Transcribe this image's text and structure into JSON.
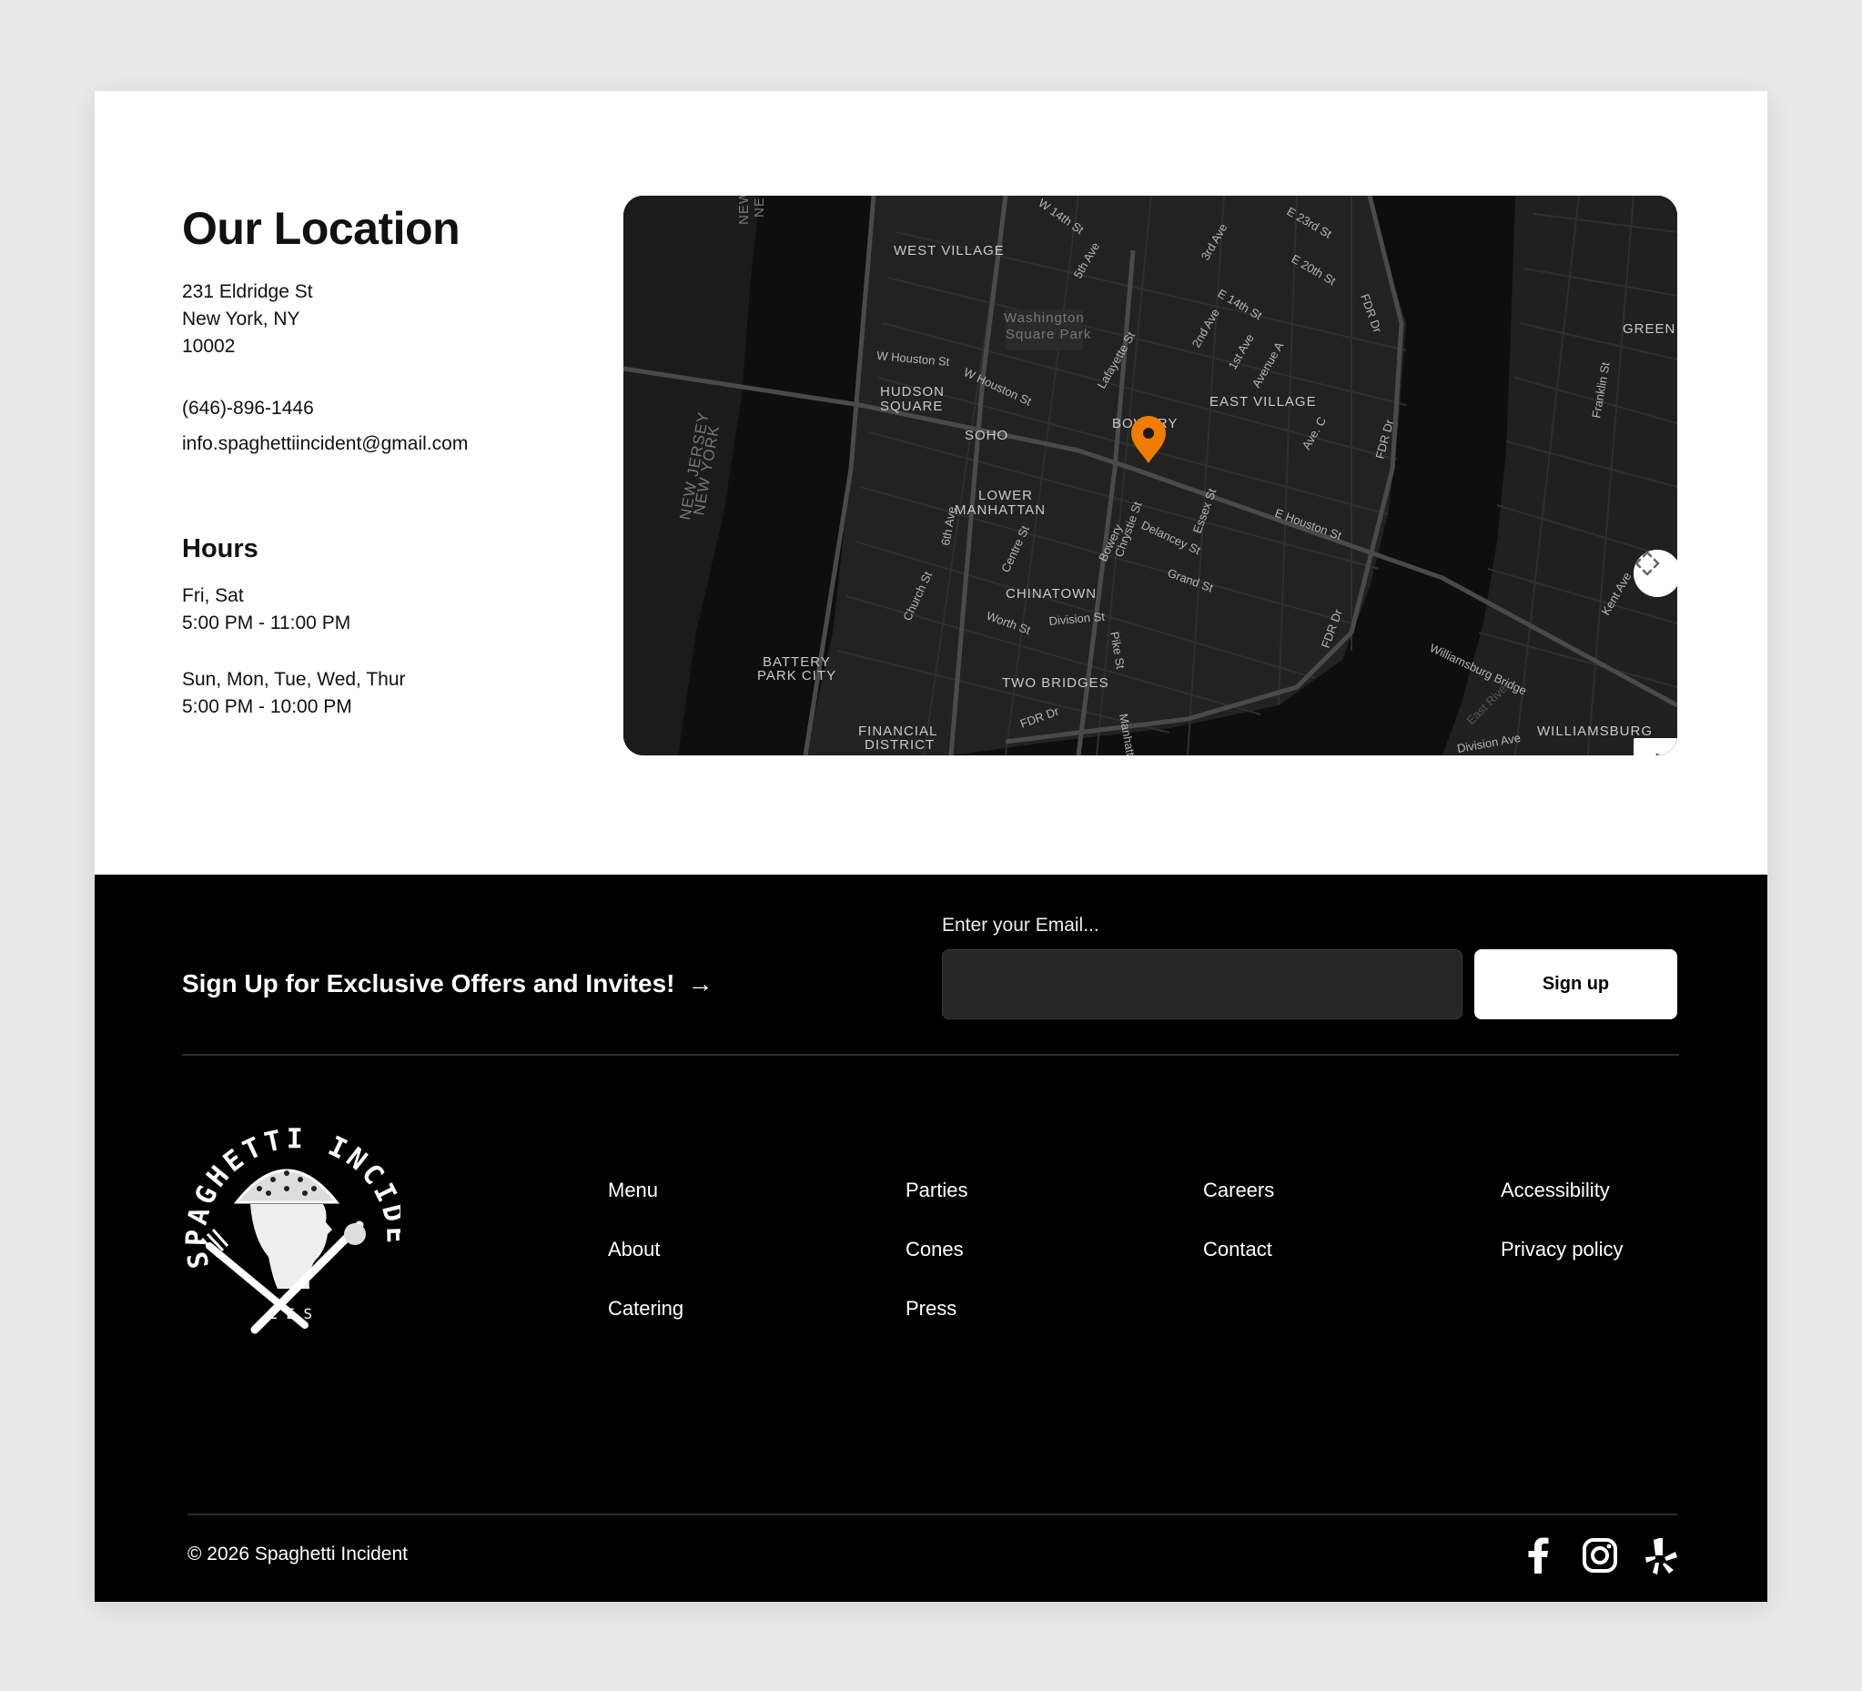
{
  "location": {
    "title": "Our Location",
    "address_line1": "231 Eldridge St",
    "address_line2": "New York, NY",
    "address_line3": "10002",
    "phone": "(646)-896-1446",
    "email": "info.spaghettiincident@gmail.com"
  },
  "hours": {
    "title": "Hours",
    "blocks": [
      {
        "days": "Fri, Sat",
        "time": "5:00 PM - 11:00 PM"
      },
      {
        "days": "Sun, Mon, Tue, Wed, Thur",
        "time": "5:00 PM - 10:00 PM"
      }
    ]
  },
  "map": {
    "labels": {
      "west_village": "WEST VILLAGE",
      "washington_sq_1": "Washington",
      "washington_sq_2": "Square Park",
      "hudson_sq_1": "HUDSON",
      "hudson_sq_2": "SQUARE",
      "soho": "SOHO",
      "bowery": "BOWERY",
      "east_village": "EAST VILLAGE",
      "lower_manhattan_1": "LOWER",
      "lower_manhattan_2": "MANHATTAN",
      "chinatown": "CHINATOWN",
      "battery_1": "BATTERY",
      "battery_2": "PARK CITY",
      "two_bridges": "TWO BRIDGES",
      "financial_1": "FINANCIAL",
      "financial_2": "DISTRICT",
      "williamsburg": "WILLIAMSBURG",
      "greenpoint": "GREEN",
      "nj_1": "NEW JERSEY",
      "nj_2": "NEW YORK",
      "nj_top_1": "NEW",
      "nj_top_2": "NE",
      "w_14th": "W 14th St",
      "fifth_ave": "5th Ave",
      "third_ave": "3rd Ave",
      "e_23rd": "E 23rd St",
      "e_20th": "E 20th St",
      "e_14th": "E 14th St",
      "fdr_1": "FDR Dr",
      "fdr_2": "FDR Dr",
      "fdr_3": "FDR Dr",
      "fdr_4": "FDR Dr",
      "second_ave": "2nd Ave",
      "first_ave": "1st Ave",
      "avenue_a": "Avenue A",
      "lafayette": "Lafayette St",
      "w_houston_1": "W Houston St",
      "w_houston_2": "W Houston St",
      "ave_c": "Ave. C",
      "e_houston": "E Houston St",
      "essex": "Essex St",
      "chrystie": "Chrystie St",
      "delancey": "Delancey St",
      "bowery_st": "Bowery",
      "centre": "Centre St",
      "sixth_ave": "6th Ave",
      "church": "Church St",
      "grand": "Grand St",
      "worth": "Worth St",
      "division": "Division St",
      "pike": "Pike St",
      "manhattan_br": "Manhatt",
      "williamsburg_br": "Williamsburg Bridge",
      "east_river": "East River",
      "kent": "Kent Ave",
      "franklin": "Franklin St",
      "division_ave": "Division Ave"
    },
    "marker_color": "#f07d00",
    "zoom_in": "+",
    "zoom_out": "−"
  },
  "footer": {
    "signup_text": "Sign Up for Exclusive Offers and Invites!",
    "signup_arrow": "→",
    "email_label": "Enter your Email...",
    "email_value": "",
    "email_placeholder": "",
    "signup_button": "Sign up",
    "links_col1": [
      "Menu",
      "About",
      "Catering"
    ],
    "links_col2": [
      "Parties",
      "Cones",
      "Press"
    ],
    "links_col3": [
      "Careers",
      "Contact"
    ],
    "links_col4": [
      "Accessibility",
      "Privacy policy"
    ],
    "copyright": "© 2026 Spaghetti Incident",
    "logo": {
      "arc_text": "SPAGHETTI INCIDENT",
      "letters": "L E S"
    },
    "socials": [
      "facebook-icon",
      "instagram-icon",
      "yelp-icon"
    ]
  }
}
